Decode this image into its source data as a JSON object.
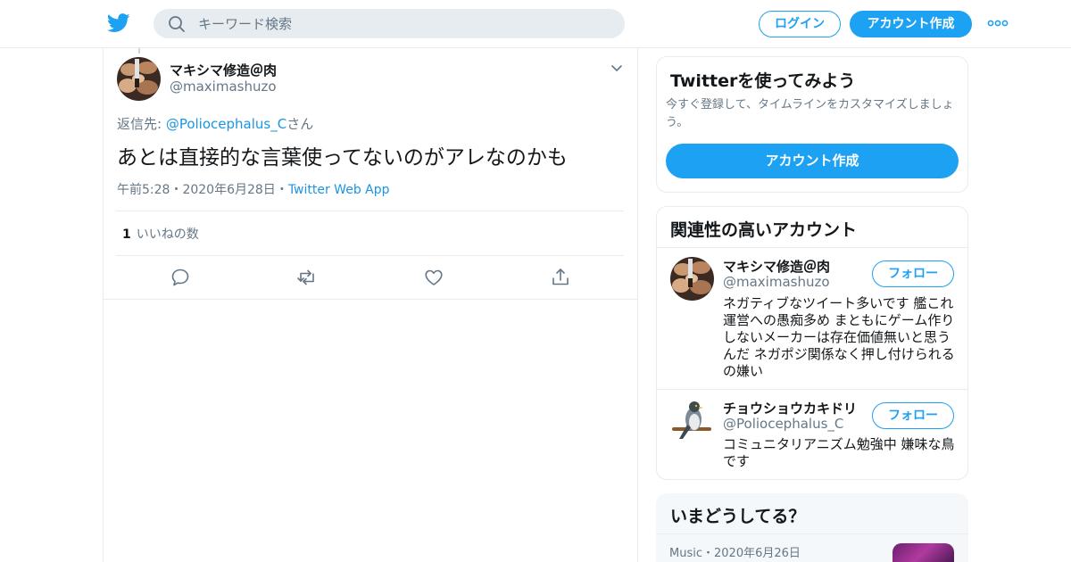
{
  "header": {
    "search_placeholder": "キーワード検索",
    "login_label": "ログイン",
    "signup_label": "アカウント作成",
    "brand_color": "#1da1f2"
  },
  "tweet": {
    "author_name": "マキシマ修造＠肉",
    "author_handle": "@maximashuzo",
    "reply_prefix": "返信先: ",
    "reply_mention": "@Poliocephalus_C",
    "reply_suffix": "さん",
    "text": "あとは直接的な言葉使ってないのがアレなのかも",
    "time": "午前5:28",
    "date": "2020年6月28日",
    "separator": "・",
    "app": "Twitter Web App",
    "like_count": "1",
    "like_label": "いいねの数"
  },
  "signup_card": {
    "title": "Twitterを使ってみよう",
    "description": "今すぐ登録して、タイムラインをカスタマイズしましょう。",
    "button_label": "アカウント作成"
  },
  "related": {
    "title": "関連性の高いアカウント",
    "accounts": [
      {
        "name": "マキシマ修造＠肉",
        "handle": "@maximashuzo",
        "bio": "ネガティブなツイート多いです 艦これ運営への愚痴多め まともにゲーム作りしないメーカーは存在価値無いと思うんだ ネガポジ関係なく押し付けられるの嫌い",
        "follow_label": "フォロー"
      },
      {
        "name": "チョウショウカキドリ",
        "handle": "@Poliocephalus_C",
        "bio": "コミュニタリアニズム勉強中 嫌味な鳥です",
        "follow_label": "フォロー"
      }
    ]
  },
  "trends": {
    "title": "いまどうしてる？",
    "items": [
      {
        "category": "Music",
        "separator": "・",
        "date": "2020年6月26日"
      }
    ]
  }
}
